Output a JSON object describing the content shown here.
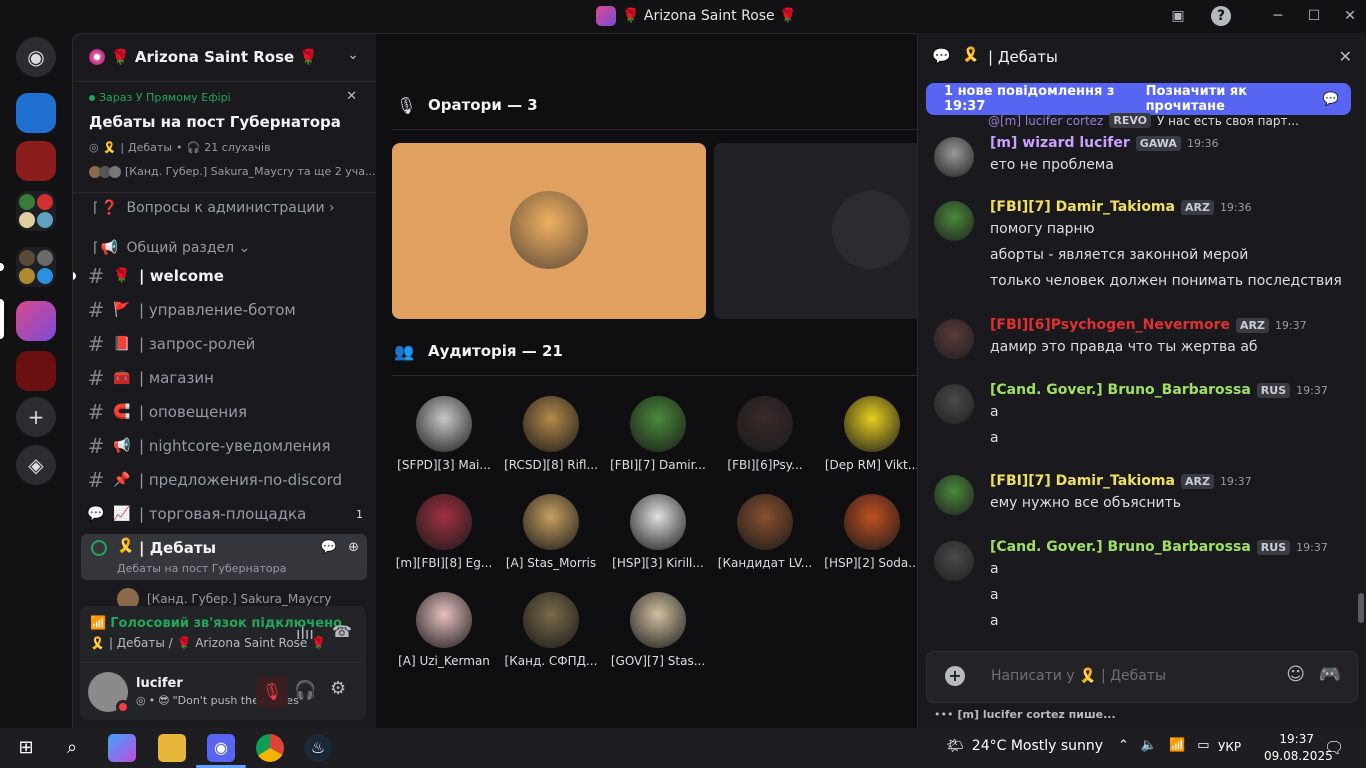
{
  "window": {
    "title": "🌹 Arizona Saint Rose 🌹",
    "server_name": "🌹 Arizona Saint Rose 🌹"
  },
  "live": {
    "status": "Зараз У Прямому Ефірі",
    "title": "Дебаты на пост Губернатора",
    "meta_channel": "Дебаты",
    "meta_listeners": "21 слухачів",
    "participants": "[Канд. Губер.] Sakura_Maycry та ще 2 уча..."
  },
  "channels": [
    {
      "icon": "❓",
      "label": "Вопросы к администрации ›",
      "kind": "category"
    },
    {
      "icon": "📢",
      "label": "Общий раздел ⌄",
      "kind": "category"
    },
    {
      "icon": "🌹",
      "label": "| welcome",
      "kind": "text",
      "unread": true
    },
    {
      "icon": "🚩",
      "label": "| управление-ботом",
      "kind": "text"
    },
    {
      "icon": "📕",
      "label": "| запрос-ролей",
      "kind": "text"
    },
    {
      "icon": "🧰",
      "label": "| магазин",
      "kind": "text"
    },
    {
      "icon": "🧲",
      "label": "| оповещения",
      "kind": "text"
    },
    {
      "icon": "📢",
      "label": "| nightcore-уведомления",
      "kind": "text"
    },
    {
      "icon": "📌",
      "label": "| предложения-по-discord",
      "kind": "text"
    },
    {
      "icon": "📈",
      "label": "| торговая-площадка",
      "kind": "forum",
      "badge": "1"
    }
  ],
  "active_channel": {
    "label": "| Дебаты",
    "sub": "Дебаты на пост Губернатора",
    "member": "[Канд. Губер.] Sakura_Maycry"
  },
  "voice": {
    "status": "Голосовий зв'язок підключено",
    "location": "| Дебаты / 🌹 Arizona Saint Rose 🌹"
  },
  "user": {
    "name": "lucifer",
    "status": "\"Don't push the horses\""
  },
  "stage": {
    "speakers_title": "Оратори — 3",
    "audience_title": "Аудиторія — 21",
    "audience": [
      {
        "name": "[SFPD][3] Mai...",
        "color": "#c8c8c8"
      },
      {
        "name": "[RCSD][8] Rifl...",
        "color": "#b58a4a"
      },
      {
        "name": "[FBI][7] Damir...",
        "color": "#4a8a3a"
      },
      {
        "name": "[FBI][6]Psy...",
        "color": "#3a2a2a"
      },
      {
        "name": "[Dep RM] Vikt...",
        "color": "#e8d020"
      },
      {
        "name": "[m][FBI][8] Eg...",
        "color": "#a03040"
      },
      {
        "name": "[A] Stas_Morris",
        "color": "#c8a060"
      },
      {
        "name": "[HSP][3] Kirill...",
        "color": "#e0e0e0"
      },
      {
        "name": "[Кандидат LV...",
        "color": "#8a5030"
      },
      {
        "name": "[HSP][2] Soda...",
        "color": "#c05020"
      },
      {
        "name": "[A] Uzi_Kerman",
        "color": "#e8c0c0"
      },
      {
        "name": "[Канд. СФПД...",
        "color": "#7a6a4a"
      },
      {
        "name": "[GOV][7] Stas...",
        "color": "#d0c0a0"
      }
    ]
  },
  "chat": {
    "title": "| Дебаты",
    "new_banner": "1 нове повідомлення з 19:37",
    "mark_read": "Позначити як прочитане",
    "reply_preview": "@[m] lucifer cortez",
    "reply_tag": "REVO",
    "reply_text": "У нас есть своя парт...",
    "input_placeholder": "Написати у 🎗️ | Дебаты",
    "typing": "[m] lucifer cortez пише...",
    "messages": [
      {
        "author": "[m] wizard lucifer",
        "color": "#c9a0ff",
        "tag": "GAWA",
        "time": "19:36",
        "lines": [
          "ето не проблема"
        ]
      },
      {
        "author": "[FBI][7] Damir_Takioma",
        "color": "#f0e060",
        "tag": "ARZ",
        "time": "19:36",
        "lines": [
          "помогу парню",
          "аборты - является законной мерой",
          "только человек должен понимать последствия"
        ]
      },
      {
        "author": "[FBI][6]Psychogen_Nevermore",
        "color": "#e03030",
        "tag": "ARZ",
        "time": "19:37",
        "lines": [
          "дамир это правда что ты жертва аб"
        ]
      },
      {
        "author": "[Cand. Gover.] Bruno_Barbarossa",
        "color": "#a0e060",
        "tag": "RUS",
        "time": "19:37",
        "lines": [
          "а",
          "а"
        ]
      },
      {
        "author": "[FBI][7] Damir_Takioma",
        "color": "#f0e060",
        "tag": "ARZ",
        "time": "19:37",
        "lines": [
          "ему нужно все объяснить"
        ]
      },
      {
        "author": "[Cand. Gover.] Bruno_Barbarossa",
        "color": "#a0e060",
        "tag": "RUS",
        "time": "19:37",
        "lines": [
          "а",
          "а",
          "а"
        ]
      }
    ]
  },
  "taskbar": {
    "weather": "24°C  Mostly sunny",
    "lang": "УКР",
    "time": "19:37",
    "date": "09.08.2025"
  }
}
